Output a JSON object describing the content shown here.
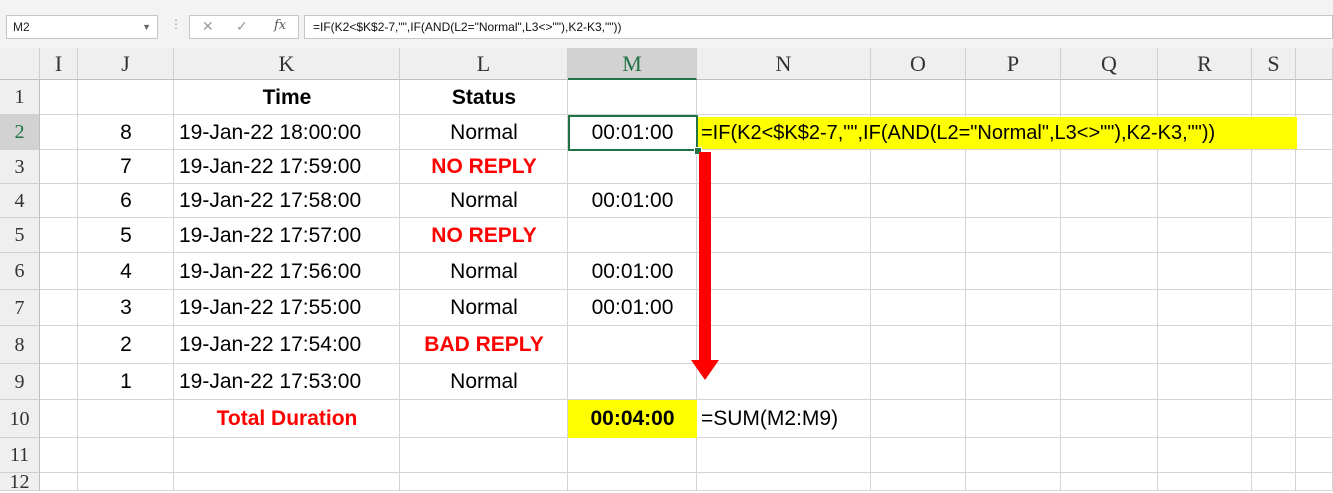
{
  "formula_bar": {
    "name_box": "M2",
    "cancel_icon": "✕",
    "enter_icon": "✓",
    "fx_label": "fx",
    "formula": "=IF(K2<$K$2-7,\"\",IF(AND(L2=\"Normal\",L3<>\"\"),K2-K3,\"\"))"
  },
  "columns": [
    "I",
    "J",
    "K",
    "L",
    "M",
    "N",
    "O",
    "P",
    "Q",
    "R",
    "S"
  ],
  "rows": [
    "1",
    "2",
    "3",
    "4",
    "5",
    "6",
    "7",
    "8",
    "9",
    "10",
    "11",
    "12"
  ],
  "selected_cell": "M2",
  "header_row": {
    "time": "Time",
    "status": "Status"
  },
  "data_rows": [
    {
      "row": "2",
      "j": "8",
      "time": "19-Jan-22 18:00:00",
      "status": "Normal",
      "status_red": false,
      "duration": "00:01:00"
    },
    {
      "row": "3",
      "j": "7",
      "time": "19-Jan-22 17:59:00",
      "status": "NO REPLY",
      "status_red": true,
      "duration": ""
    },
    {
      "row": "4",
      "j": "6",
      "time": "19-Jan-22 17:58:00",
      "status": "Normal",
      "status_red": false,
      "duration": "00:01:00"
    },
    {
      "row": "5",
      "j": "5",
      "time": "19-Jan-22 17:57:00",
      "status": "NO REPLY",
      "status_red": true,
      "duration": ""
    },
    {
      "row": "6",
      "j": "4",
      "time": "19-Jan-22 17:56:00",
      "status": "Normal",
      "status_red": false,
      "duration": "00:01:00"
    },
    {
      "row": "7",
      "j": "3",
      "time": "19-Jan-22 17:55:00",
      "status": "Normal",
      "status_red": false,
      "duration": "00:01:00"
    },
    {
      "row": "8",
      "j": "2",
      "time": "19-Jan-22 17:54:00",
      "status": "BAD REPLY",
      "status_red": true,
      "duration": ""
    },
    {
      "row": "9",
      "j": "1",
      "time": "19-Jan-22 17:53:00",
      "status": "Normal",
      "status_red": false,
      "duration": ""
    }
  ],
  "annotations": {
    "formula_note": "=IF(K2<$K$2-7,\"\",IF(AND(L2=\"Normal\",L3<>\"\"),K2-K3,\"\"))",
    "total_label": "Total Duration",
    "total_value": "00:04:00",
    "sum_note": "=SUM(M2:M9)"
  },
  "colors": {
    "highlight": "#ffff00",
    "red_text": "#ff0000",
    "selection": "#217346",
    "arrow": "#ff0000"
  }
}
